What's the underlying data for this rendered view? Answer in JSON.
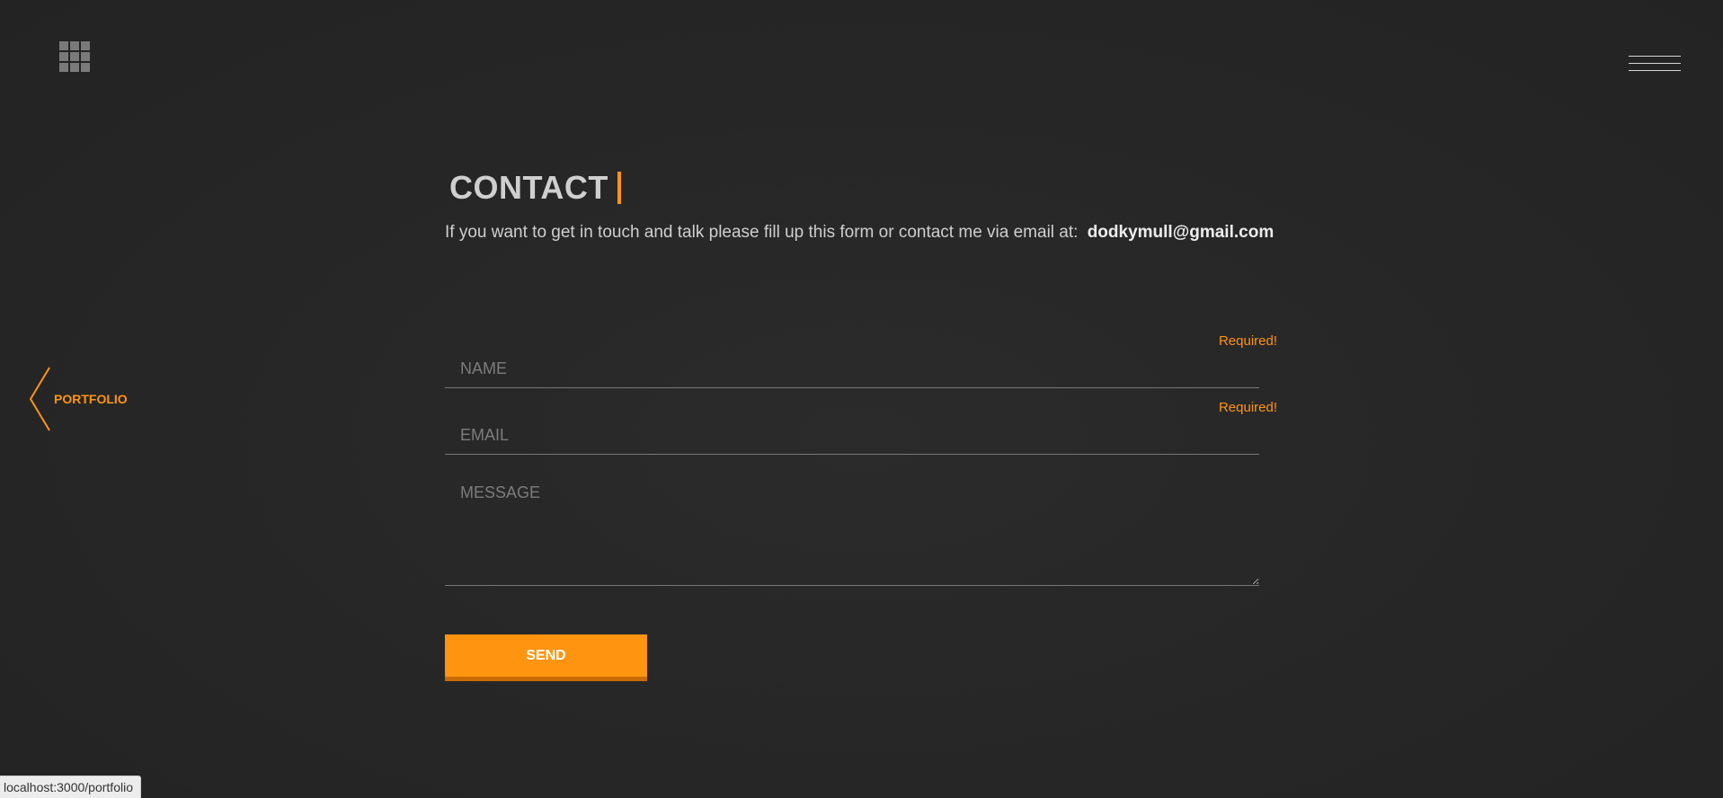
{
  "header": {
    "logo_icon": "grid-icon",
    "menu_icon": "hamburger-icon"
  },
  "nav": {
    "prev_label": "PORTFOLIO",
    "prev_icon": "chevron-left-icon"
  },
  "contact": {
    "title": "CONTACT",
    "intro": "If you want to get in touch and talk please fill up this form or contact me via email at:",
    "email": "dodkymull@gmail.com"
  },
  "form": {
    "name": {
      "placeholder": "NAME",
      "value": "",
      "error": "Required!"
    },
    "email": {
      "placeholder": "EMAIL",
      "value": "",
      "error": "Required!"
    },
    "message": {
      "placeholder": "MESSAGE",
      "value": ""
    },
    "submit_label": "SEND"
  },
  "status_bar": {
    "url": "localhost:3000/portfolio"
  },
  "colors": {
    "accent": "#ff9410",
    "background": "#272727",
    "text": "#cfcfcf"
  }
}
